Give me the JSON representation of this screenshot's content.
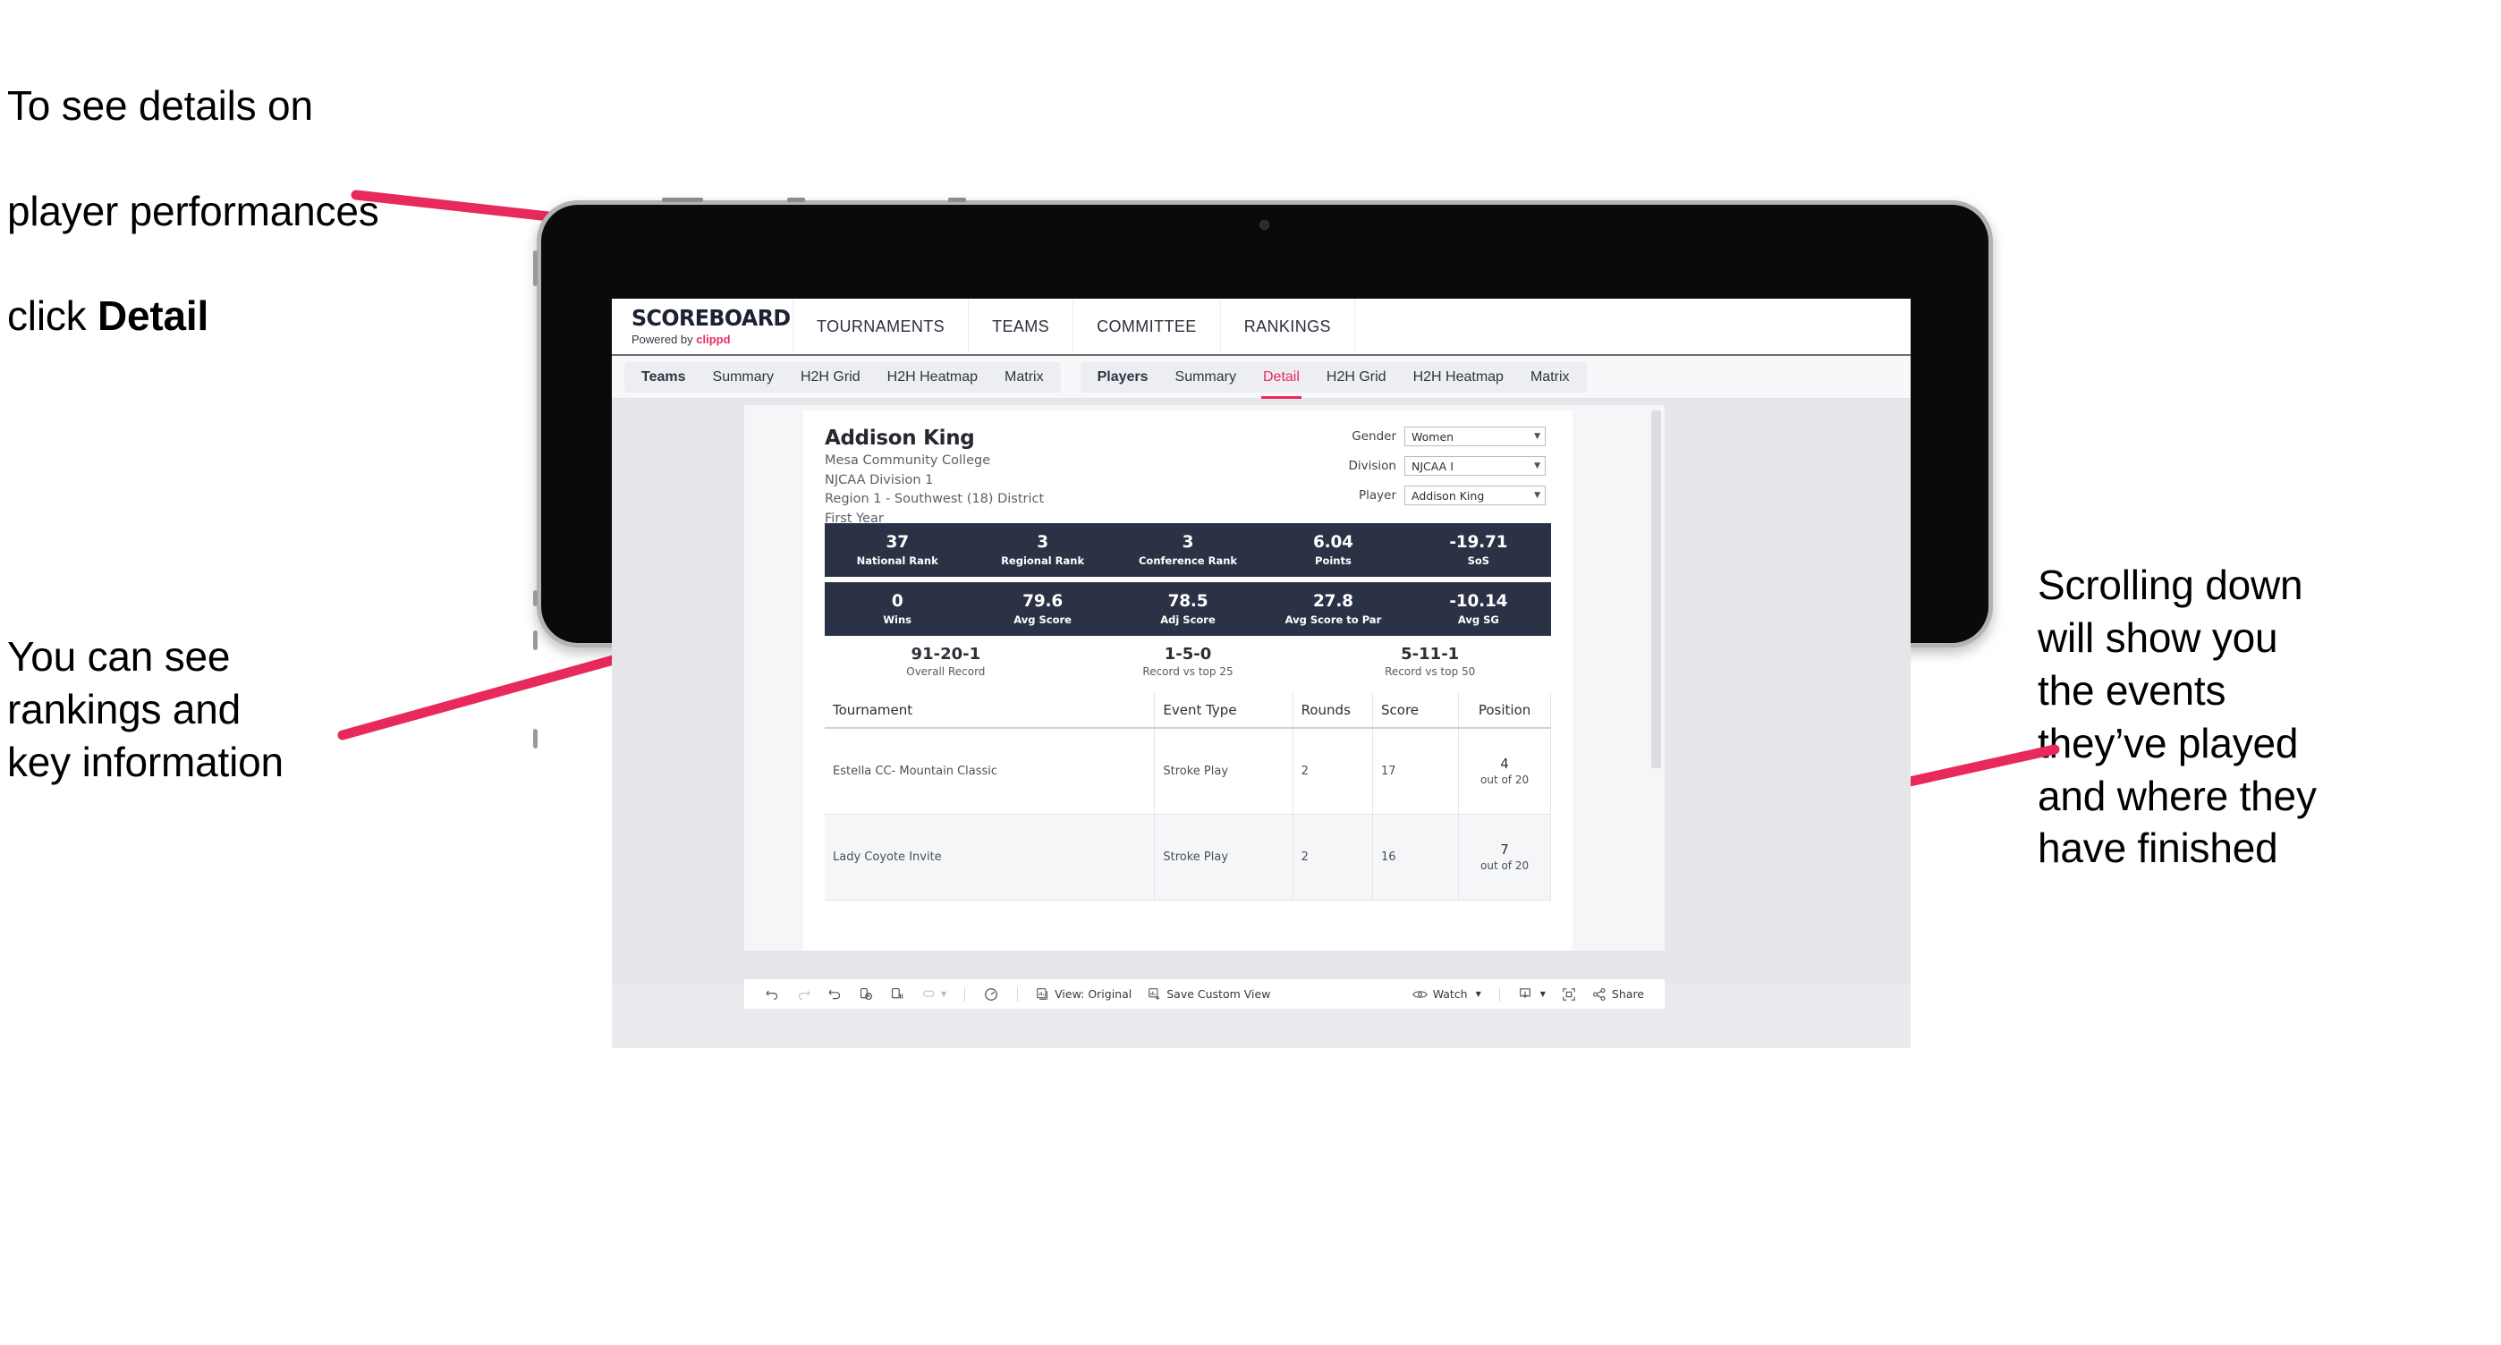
{
  "annotations": {
    "detail_note_line1": "To see details on",
    "detail_note_line2": "player performances",
    "detail_note_line3_prefix": "click ",
    "detail_note_line3_bold": "Detail",
    "rankings_note": "You can see\nrankings and\nkey information",
    "scrolling_note": "Scrolling down\nwill show you\nthe events\nthey’ve played\nand where they\nhave finished",
    "arrow_color": "#e8295b"
  },
  "app": {
    "logo_title": "SCOREBOARD",
    "logo_powered_prefix": "Powered by ",
    "logo_brand": "clippd",
    "top_nav": [
      {
        "label": "TOURNAMENTS"
      },
      {
        "label": "TEAMS"
      },
      {
        "label": "COMMITTEE"
      },
      {
        "label": "RANKINGS"
      }
    ],
    "subnav_teams": [
      {
        "label": "Teams"
      },
      {
        "label": "Summary"
      },
      {
        "label": "H2H Grid"
      },
      {
        "label": "H2H Heatmap"
      },
      {
        "label": "Matrix"
      }
    ],
    "subnav_players": [
      {
        "label": "Players"
      },
      {
        "label": "Summary"
      },
      {
        "label": "Detail"
      },
      {
        "label": "H2H Grid"
      },
      {
        "label": "H2H Heatmap"
      },
      {
        "label": "Matrix"
      }
    ],
    "active_subnav": "Detail",
    "accent_color": "#e8295b",
    "stat_bar_color": "#2c3246"
  },
  "player": {
    "name": "Addison King",
    "school": "Mesa Community College",
    "division": "NJCAA Division 1",
    "region": "Region 1 - Southwest (18) District",
    "year": "First Year"
  },
  "filters": [
    {
      "label": "Gender",
      "value": "Women"
    },
    {
      "label": "Division",
      "value": "NJCAA I"
    },
    {
      "label": "Player",
      "value": "Addison King"
    }
  ],
  "stats_row1": [
    {
      "value": "37",
      "label": "National Rank"
    },
    {
      "value": "3",
      "label": "Regional Rank"
    },
    {
      "value": "3",
      "label": "Conference Rank"
    },
    {
      "value": "6.04",
      "label": "Points"
    },
    {
      "value": "-19.71",
      "label": "SoS"
    }
  ],
  "stats_row2": [
    {
      "value": "0",
      "label": "Wins"
    },
    {
      "value": "79.6",
      "label": "Avg Score"
    },
    {
      "value": "78.5",
      "label": "Adj Score"
    },
    {
      "value": "27.8",
      "label": "Avg Score to Par"
    },
    {
      "value": "-10.14",
      "label": "Avg SG"
    }
  ],
  "records": [
    {
      "value": "91-20-1",
      "label": "Overall Record"
    },
    {
      "value": "1-5-0",
      "label": "Record vs top 25"
    },
    {
      "value": "5-11-1",
      "label": "Record vs top 50"
    }
  ],
  "events_table": {
    "columns": [
      "Tournament",
      "Event Type",
      "Rounds",
      "Score",
      "Position"
    ],
    "rows": [
      {
        "tournament": "Estella CC- Mountain Classic",
        "event_type": "Stroke Play",
        "rounds": "2",
        "score": "17",
        "position_num": "4",
        "position_sub": "out of 20"
      },
      {
        "tournament": "Lady Coyote Invite",
        "event_type": "Stroke Play",
        "rounds": "2",
        "score": "16",
        "position_num": "7",
        "position_sub": "out of 20"
      }
    ]
  },
  "toolbar": {
    "view_label": "View: Original",
    "save_label": "Save Custom View",
    "watch_label": "Watch",
    "share_label": "Share"
  }
}
